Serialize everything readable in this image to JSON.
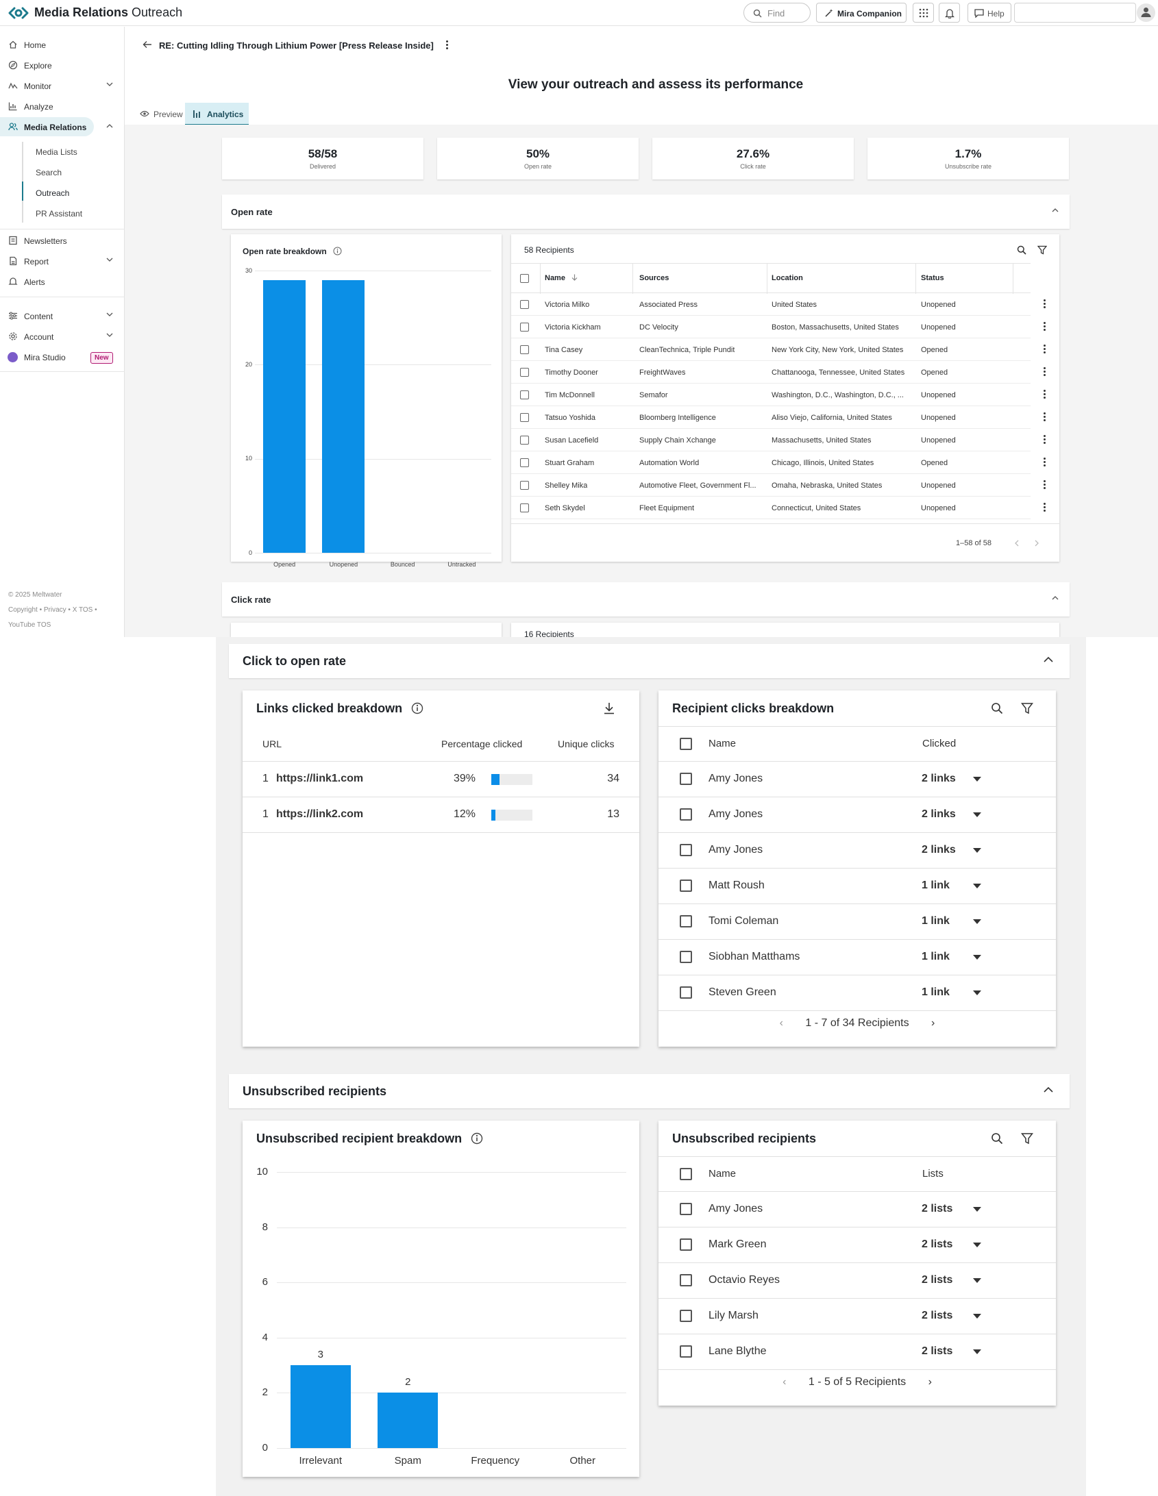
{
  "app": {
    "brand_bold": "Media Relations",
    "brand_light": "Outreach"
  },
  "topbar": {
    "find_placeholder": "Find",
    "companion_label": "Mira Companion",
    "help_label": "Help"
  },
  "sidebar": {
    "items": [
      {
        "label": "Home",
        "icon": "home-icon"
      },
      {
        "label": "Explore",
        "icon": "compass-icon"
      },
      {
        "label": "Monitor",
        "icon": "monitor-icon"
      },
      {
        "label": "Analyze",
        "icon": "analyze-icon"
      },
      {
        "label": "Media Relations",
        "icon": "people-icon"
      },
      {
        "label": "Newsletters",
        "icon": "newsletter-icon"
      },
      {
        "label": "Report",
        "icon": "report-icon"
      },
      {
        "label": "Alerts",
        "icon": "bell-icon"
      },
      {
        "label": "Content",
        "icon": "sliders-icon"
      },
      {
        "label": "Account",
        "icon": "gear-icon"
      },
      {
        "label": "Mira Studio",
        "icon": "mira-icon"
      }
    ],
    "sub_items": [
      "Media Lists",
      "Search",
      "Outreach",
      "PR Assistant"
    ],
    "new_badge": "New",
    "footer": [
      "© 2025 Meltwater",
      "Copyright • Privacy • X TOS •",
      "YouTube TOS"
    ]
  },
  "header": {
    "email_title": "RE: Cutting Idling Through Lithium Power [Press Release Inside]",
    "page_heading": "View your outreach and assess its performance",
    "tabs": [
      "Preview",
      "Analytics"
    ]
  },
  "kpis": [
    {
      "value": "58/58",
      "label": "Delivered"
    },
    {
      "value": "50%",
      "label": "Open rate"
    },
    {
      "value": "27.6%",
      "label": "Click rate"
    },
    {
      "value": "1.7%",
      "label": "Unsubscribe rate"
    }
  ],
  "open_rate": {
    "section_title": "Open rate",
    "chart_title": "Open rate breakdown",
    "recipients_title": "58 Recipients",
    "columns": [
      "Name",
      "Sources",
      "Location",
      "Status"
    ],
    "rows": [
      [
        "Victoria Milko",
        "Associated Press",
        "United States",
        "Unopened"
      ],
      [
        "Victoria Kickham",
        "DC Velocity",
        "Boston, Massachusetts, United States",
        "Unopened"
      ],
      [
        "Tina Casey",
        "CleanTechnica, Triple Pundit",
        "New York City, New York, United States",
        "Opened"
      ],
      [
        "Timothy Dooner",
        "FreightWaves",
        "Chattanooga, Tennessee, United States",
        "Opened"
      ],
      [
        "Tim McDonnell",
        "Semafor",
        "Washington, D.C., Washington, D.C., ...",
        "Unopened"
      ],
      [
        "Tatsuo Yoshida",
        "Bloomberg Intelligence",
        "Aliso Viejo, California, United States",
        "Unopened"
      ],
      [
        "Susan Lacefield",
        "Supply Chain Xchange",
        "Massachusetts, United States",
        "Unopened"
      ],
      [
        "Stuart Graham",
        "Automation World",
        "Chicago, Illinois, United States",
        "Opened"
      ],
      [
        "Shelley Mika",
        "Automotive Fleet, Government Fl...",
        "Omaha, Nebraska, United States",
        "Unopened"
      ],
      [
        "Seth Skydel",
        "Fleet Equipment",
        "Connecticut, United States",
        "Unopened"
      ]
    ],
    "pagination": "1–58 of 58"
  },
  "click_rate": {
    "section_title": "Click rate",
    "peek_recipients": "16 Recipients"
  },
  "click_to_open": {
    "section_title": "Click to open rate",
    "links_title": "Links clicked breakdown",
    "links_columns": [
      "URL",
      "Percentage clicked",
      "Unique clicks"
    ],
    "links": [
      {
        "index": "1",
        "url": "https://link1.com",
        "pct_label": "39%",
        "pct": 0.39,
        "clicks": "34"
      },
      {
        "index": "1",
        "url": "https://link2.com",
        "pct_label": "12%",
        "pct": 0.12,
        "clicks": "13"
      }
    ],
    "recipients_title": "Recipient clicks breakdown",
    "recipient_columns": [
      "Name",
      "Clicked"
    ],
    "recipients": [
      {
        "name": "Amy Jones",
        "clicked": "2 links"
      },
      {
        "name": "Amy Jones",
        "clicked": "2 links"
      },
      {
        "name": "Amy Jones",
        "clicked": "2 links"
      },
      {
        "name": "Matt Roush",
        "clicked": "1 link"
      },
      {
        "name": "Tomi Coleman",
        "clicked": "1 link"
      },
      {
        "name": "Siobhan Matthams",
        "clicked": "1 link"
      },
      {
        "name": "Steven Green",
        "clicked": "1 link"
      }
    ],
    "pagination": "1 - 7 of 34 Recipients"
  },
  "unsubscribed": {
    "section_title": "Unsubscribed recipients",
    "chart_title": "Unsubscribed recipient breakdown",
    "list_title": "Unsubscribed recipients",
    "columns": [
      "Name",
      "Lists"
    ],
    "rows": [
      {
        "name": "Amy Jones",
        "lists": "2 lists"
      },
      {
        "name": "Mark Green",
        "lists": "2 lists"
      },
      {
        "name": "Octavio Reyes",
        "lists": "2 lists"
      },
      {
        "name": "Lily Marsh",
        "lists": "2 lists"
      },
      {
        "name": "Lane Blythe",
        "lists": "2 lists"
      }
    ],
    "pagination": "1 - 5 of 5 Recipients"
  },
  "colors": {
    "accent": "#1b7a8c",
    "bar": "#0b8fe6",
    "badge": "#b01a72"
  },
  "chart_data": [
    {
      "type": "bar",
      "title": "Open rate breakdown",
      "categories": [
        "Opened",
        "Unopened",
        "Bounced",
        "Untracked"
      ],
      "values": [
        29,
        29,
        0,
        0
      ],
      "ylim": [
        0,
        30
      ],
      "yticks": [
        "0",
        "10",
        "20",
        "30"
      ],
      "grid": true
    },
    {
      "type": "bar",
      "title": "Unsubscribed recipient breakdown",
      "categories": [
        "Irrelevant",
        "Spam",
        "Frequency",
        "Other"
      ],
      "values": [
        3,
        2,
        0,
        0
      ],
      "data_labels": [
        "3",
        "2",
        "",
        ""
      ],
      "ylim": [
        0,
        10
      ],
      "yticks": [
        "0",
        "2",
        "4",
        "6",
        "8",
        "10"
      ],
      "grid": true
    }
  ]
}
